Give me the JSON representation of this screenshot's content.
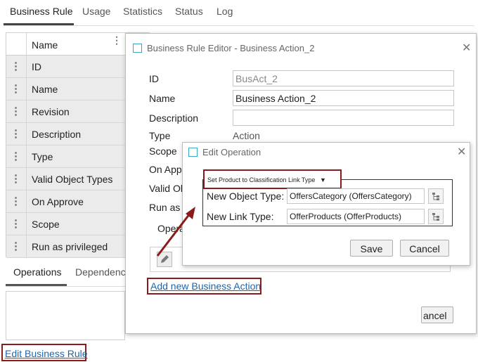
{
  "top_tabs": [
    "Business Rule",
    "Usage",
    "Statistics",
    "Status",
    "Log"
  ],
  "properties": {
    "header": "Name",
    "rows": [
      "ID",
      "Name",
      "Revision",
      "Description",
      "Type",
      "Valid Object Types",
      "On Approve",
      "Scope",
      "Run as privileged"
    ]
  },
  "lower_tabs": [
    "Operations",
    "Dependencies"
  ],
  "edit_business_rule_link": "Edit Business Rule",
  "editor": {
    "title": "Business Rule Editor - Business Action_2",
    "id_label": "ID",
    "id_value": "BusAct_2",
    "name_label": "Name",
    "name_value": "Business Action_2",
    "description_label": "Description",
    "description_value": "",
    "type_label": "Type",
    "type_value": "Action",
    "scope_label": "Scope",
    "on_approve_label": "On App",
    "valid_objects_label": "Valid Ob",
    "run_as_label": "Run as",
    "operations_tab": "Opera",
    "add_link": "Add new Business Action",
    "cancel_label": "ancel"
  },
  "edit_operation": {
    "title": "Edit Operation",
    "operation_type": "Set Product to Classification Link Type",
    "new_object_type_label": "New Object Type:",
    "new_object_type_value": "OffersCategory (OffersCategory)",
    "new_link_type_label": "New Link Type:",
    "new_link_type_value": "OfferProducts (OfferProducts)",
    "save_label": "Save",
    "cancel_label": "Cancel"
  },
  "colors": {
    "highlight": "#8b1a1a",
    "link": "#1a66b0",
    "dialog_icon": "#3aa6c4"
  }
}
